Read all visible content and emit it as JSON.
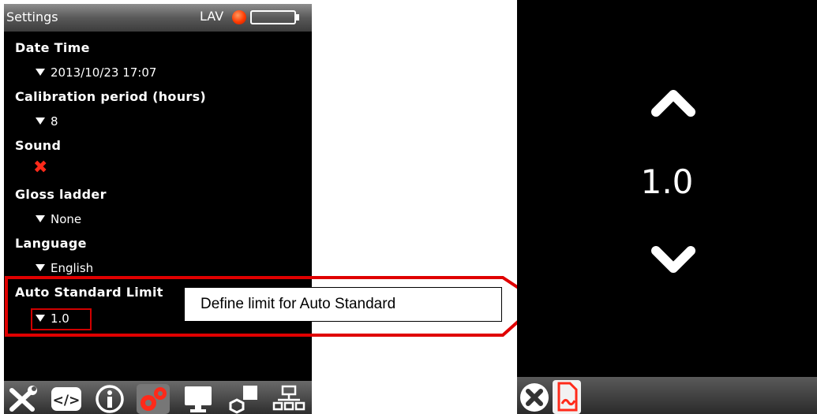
{
  "left_screen": {
    "header": {
      "title": "Settings",
      "mode": "LAV"
    },
    "settings": {
      "date_time": {
        "label": "Date Time",
        "value": "2013/10/23 17:07"
      },
      "calibration_period": {
        "label": "Calibration period (hours)",
        "value": "8"
      },
      "sound": {
        "label": "Sound",
        "state_icon": "red-x-icon"
      },
      "gloss_ladder": {
        "label": "Gloss ladder",
        "value": "None"
      },
      "language": {
        "label": "Language",
        "value": "English"
      },
      "auto_standard_limit": {
        "label": "Auto Standard Limit",
        "value": "1.0"
      }
    },
    "toolbar_icons": [
      "tools-icon",
      "code-icon",
      "info-icon",
      "settings-gears-icon",
      "monitor-icon",
      "shapes-icon",
      "network-icon"
    ]
  },
  "callout": {
    "text": "Define limit for Auto Standard",
    "color": "#e00000"
  },
  "right_screen": {
    "value": "1.0",
    "up_icon": "chevron-up-icon",
    "down_icon": "chevron-down-icon",
    "toolbar_icons": [
      "cancel-icon",
      "document-sign-icon"
    ]
  },
  "colors": {
    "accent_red": "#e00000",
    "screen_bg": "#000000"
  }
}
